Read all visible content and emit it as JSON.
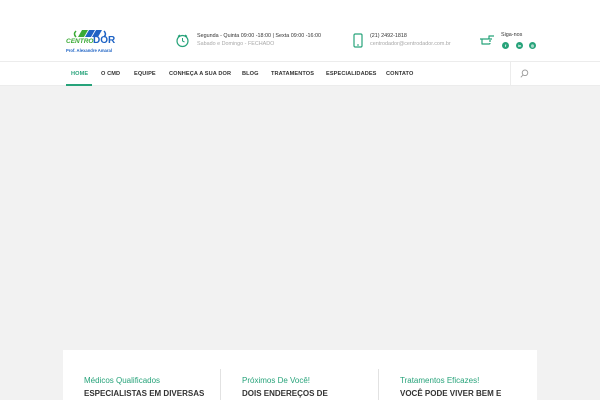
{
  "header": {
    "logo": {
      "line1": "CENTRO",
      "line2": "DOR",
      "line3": "Prof. Alexandre Amaral"
    },
    "hours": {
      "line1": "Segunda - Quinta 09:00 -18:00 | Sexta 09:00 -16:00",
      "line2": "Sabado e Domingo - FECHADO",
      "icon": "clock-icon"
    },
    "contact": {
      "phone": "(21) 2492-1818",
      "email": "centrodador@centrodador.com.br",
      "icon": "phone-icon"
    },
    "social": {
      "label": "Siga-nos",
      "icon": "pointing-hand-icon",
      "networks": [
        {
          "name": "facebook-icon",
          "glyph": "f"
        },
        {
          "name": "linkedin-icon",
          "glyph": "in"
        },
        {
          "name": "instagram-icon",
          "glyph": "◎"
        }
      ]
    }
  },
  "nav": {
    "items": [
      {
        "label": "HOME",
        "active": true
      },
      {
        "label": "O CMD"
      },
      {
        "label": "EQUIPE"
      },
      {
        "label": "CONHEÇA A SUA DOR"
      },
      {
        "label": "BLOG"
      },
      {
        "label": "TRATAMENTOS"
      },
      {
        "label": "ESPECIALIDADES"
      },
      {
        "label": "CONTATO"
      }
    ],
    "search_icon": "search-icon"
  },
  "features": [
    {
      "subtitle": "Médicos Qualificados",
      "title": "ESPECIALISTAS EM DIVERSAS"
    },
    {
      "subtitle": "Próximos De Você!",
      "title": "DOIS ENDEREÇOS DE"
    },
    {
      "subtitle": "Tratamentos Eficazes!",
      "title": "VOCÊ PODE VIVER BEM E"
    }
  ],
  "colors": {
    "accent": "#27a37a",
    "logo_blue": "#1e63c4",
    "logo_green": "#3aaa35"
  }
}
